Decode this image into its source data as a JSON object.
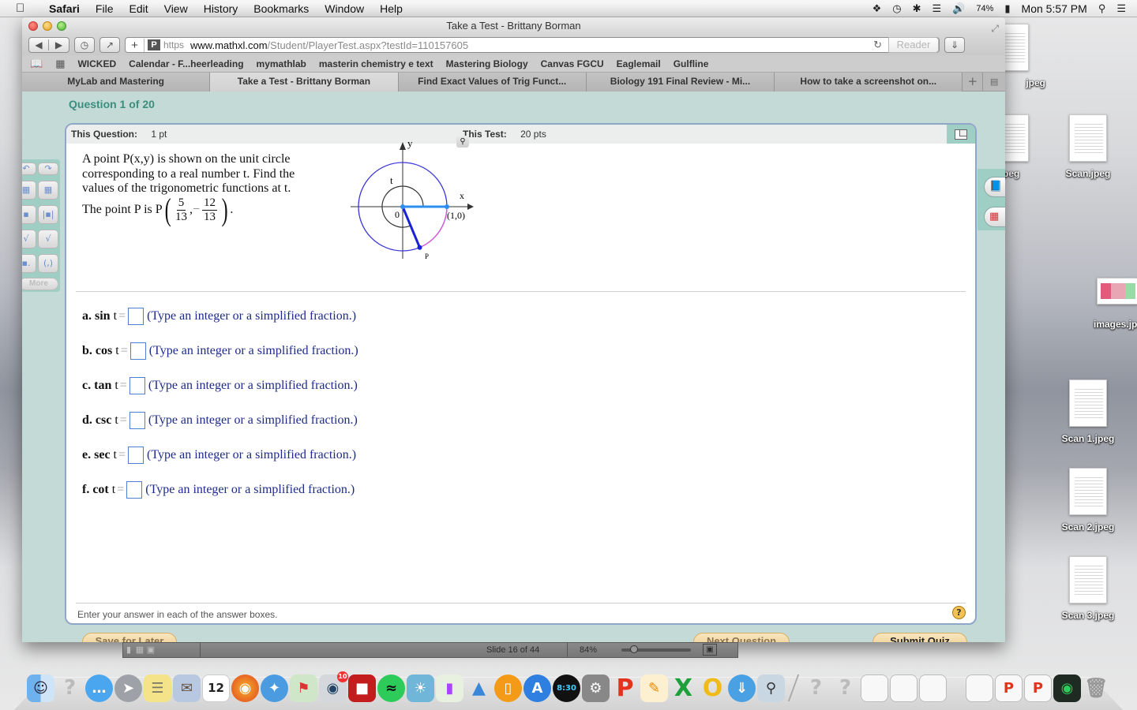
{
  "menubar": {
    "app": "Safari",
    "items": [
      "File",
      "Edit",
      "View",
      "History",
      "Bookmarks",
      "Window",
      "Help"
    ],
    "status": {
      "battery": "74%",
      "clock": "Mon 5:57 PM"
    }
  },
  "window": {
    "title": "Take a Test - Brittany Borman",
    "url": {
      "scheme": "https",
      "host": "www.mathxl.com",
      "path": "/Student/PlayerTest.aspx?testId=110157605"
    },
    "reader_label": "Reader",
    "bookmarks": [
      "WICKED",
      "Calendar - F...heerleading",
      "mymathlab",
      "masterin chemistry e text",
      "Mastering Biology",
      "Canvas FGCU",
      "Eaglemail",
      "Gulfline"
    ],
    "tabs": [
      {
        "label": "MyLab and Mastering",
        "active": false
      },
      {
        "label": "Take a Test - Brittany Borman",
        "active": true
      },
      {
        "label": "Find Exact Values of Trig Funct...",
        "active": false
      },
      {
        "label": "Biology 191 Final Review - Mi...",
        "active": false
      },
      {
        "label": "How to take a screenshot on...",
        "active": false
      }
    ]
  },
  "test": {
    "question_title": "Question 1 of 20",
    "this_question_label": "This Question:",
    "this_question_value": "1 pt",
    "this_test_label": "This Test:",
    "this_test_value": "20 pts",
    "prompt": "A point P(x,y) is shown on the unit circle corresponding to a real number t. Find the values of the trigonometric functions at t.",
    "point_prefix": "The point P is P",
    "point": {
      "x_num": "5",
      "x_den": "13",
      "y_sign": "−",
      "y_num": "12",
      "y_den": "13"
    },
    "figure": {
      "labels": {
        "y": "y",
        "x": "x",
        "t": "t",
        "origin": "0",
        "one_zero": "(1,0)",
        "p": "P"
      },
      "colors": {
        "circle": "#3b36d8",
        "arc": "#e05ad8",
        "radius_to_p": "#1a22d6",
        "radius_to_x": "#2b8ef0",
        "angle_arc": "#333333"
      }
    },
    "answers": [
      {
        "part": "a.",
        "func": "sin",
        "value": "",
        "hint": "(Type an integer or a simplified fraction.)"
      },
      {
        "part": "b.",
        "func": "cos",
        "value": "",
        "hint": "(Type an integer or a simplified fraction.)"
      },
      {
        "part": "c.",
        "func": "tan",
        "value": "",
        "hint": "(Type an integer or a simplified fraction.)"
      },
      {
        "part": "d.",
        "func": "csc",
        "value": "",
        "hint": "(Type an integer or a simplified fraction.)"
      },
      {
        "part": "e.",
        "func": "sec",
        "value": "",
        "hint": "(Type an integer or a simplified fraction.)"
      },
      {
        "part": "f.",
        "func": "cot",
        "value": "",
        "hint": "(Type an integer or a simplified fraction.)"
      }
    ],
    "t_var": "t",
    "eq": "=",
    "footer_instruction": "Enter your answer in each of the answer boxes.",
    "help_label": "?",
    "tool_more": "More",
    "buttons": {
      "save": "Save for Later",
      "next": "Next Question",
      "submit": "Submit Quiz"
    }
  },
  "presentation_strip": {
    "slide_count": "Slide 16 of 44",
    "zoom_level": "84%",
    "zoom_fraction": 0.14
  },
  "desktop_files": [
    {
      "name": "jpeg"
    },
    {
      "name": "Scan.jpeg"
    },
    {
      "name": "jpeg"
    },
    {
      "name": "images.jpe"
    },
    {
      "name": "Scan 1.jpeg"
    },
    {
      "name": "Scan 2.jpeg"
    },
    {
      "name": "Scan 3.jpeg"
    }
  ],
  "dock": {
    "calendar_day": "12",
    "facetime_badge": "10",
    "clock_time": "8:30"
  }
}
